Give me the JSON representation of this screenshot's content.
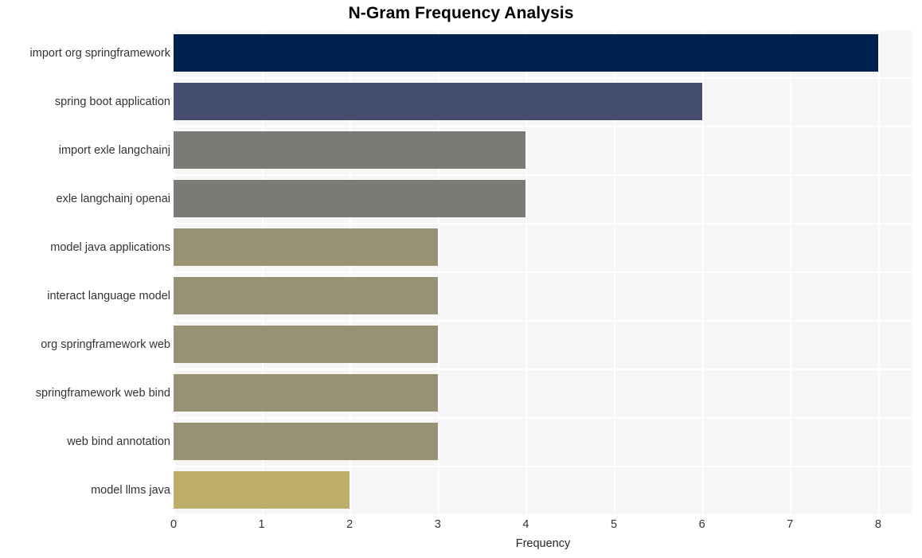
{
  "chart_data": {
    "type": "bar",
    "orientation": "horizontal",
    "title": "N-Gram Frequency Analysis",
    "xlabel": "Frequency",
    "ylabel": "",
    "categories": [
      "import org springframework",
      "spring boot application",
      "import exle langchainj",
      "exle langchainj openai",
      "model java applications",
      "interact language model",
      "org springframework web",
      "springframework web bind",
      "web bind annotation",
      "model llms java"
    ],
    "values": [
      8,
      6,
      4,
      4,
      3,
      3,
      3,
      3,
      3,
      2
    ],
    "bar_colors": [
      "#00214d",
      "#454e71",
      "#7b7a75",
      "#7b7a75",
      "#989173",
      "#989173",
      "#989173",
      "#989173",
      "#989173",
      "#bcaf6a"
    ],
    "xticks": [
      "0",
      "1",
      "2",
      "3",
      "4",
      "5",
      "6",
      "7",
      "8"
    ],
    "xtick_values": [
      0,
      1,
      2,
      3,
      4,
      5,
      6,
      7,
      8
    ],
    "xlim": [
      0,
      8.39
    ],
    "grid": true,
    "grid_color": "#ffffff",
    "plot_background": "#f6f6f7",
    "figure_background": "#ffffff",
    "legend": null,
    "title_color": "#000000",
    "tick_label_color": "#333333"
  }
}
